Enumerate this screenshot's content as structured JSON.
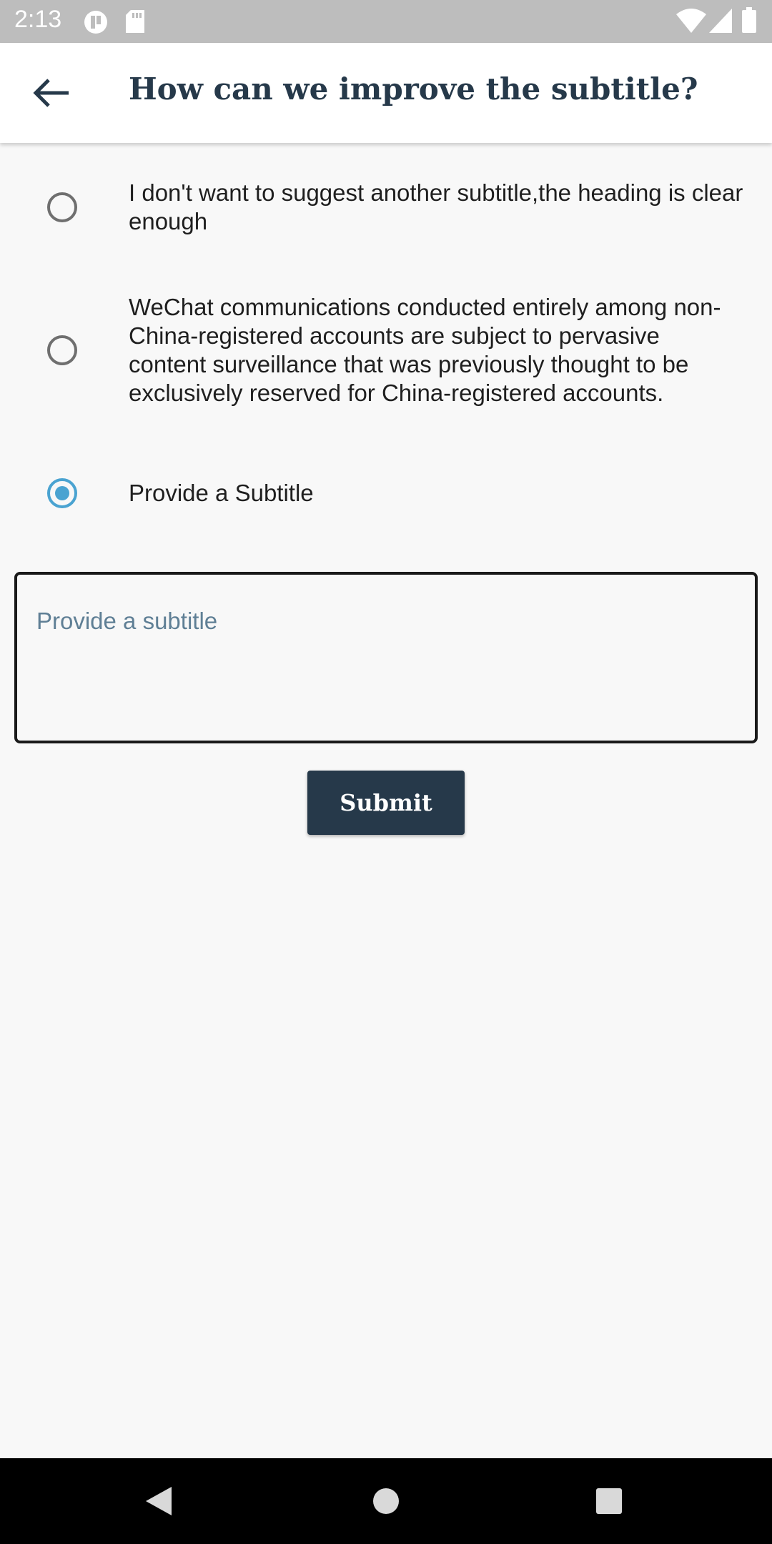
{
  "status_bar": {
    "time": "2:13",
    "icons": [
      "notification-app-icon",
      "sd-card-icon",
      "wifi-icon",
      "signal-icon",
      "battery-icon"
    ]
  },
  "header": {
    "title": "How can we improve the subtitle?",
    "back_icon": "arrow-left-icon"
  },
  "options": [
    {
      "label": "I don't want to suggest another subtitle,the heading is clear enough",
      "selected": false
    },
    {
      "label": "WeChat communications conducted entirely among non-China-registered accounts are subject to pervasive content surveillance that was previously thought to be exclusively reserved for China-registered accounts.",
      "selected": false
    },
    {
      "label": "Provide a Subtitle",
      "selected": true
    }
  ],
  "subtitle_input": {
    "placeholder": "Provide a subtitle",
    "value": ""
  },
  "submit": {
    "label": "Submit"
  },
  "nav_bar": {
    "icons": [
      "back-triangle-icon",
      "home-circle-icon",
      "recents-square-icon"
    ]
  },
  "colors": {
    "accent": "#4aa3d1",
    "title": "#26394a",
    "button_bg": "#26394a",
    "status_bar": "#bdbdbd"
  }
}
